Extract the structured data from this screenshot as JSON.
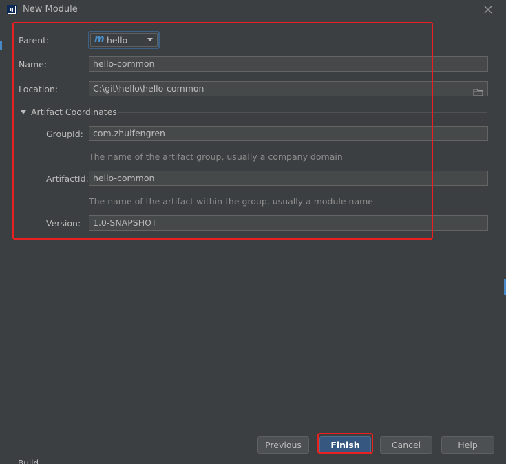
{
  "window": {
    "title": "New Module",
    "app_icon_text": "IJ"
  },
  "form": {
    "parent": {
      "label": "Parent:",
      "value": "hello",
      "icon": "maven-m-icon"
    },
    "name": {
      "label": "Name:",
      "value": "hello-common"
    },
    "location": {
      "label": "Location:",
      "value": "C:\\git\\hello\\hello-common",
      "browse_icon": "folder-icon"
    }
  },
  "artifact": {
    "section_label": "Artifact Coordinates",
    "expanded": true,
    "group_id": {
      "label": "GroupId:",
      "value": "com.zhuifengren",
      "hint": "The name of the artifact group, usually a company domain"
    },
    "artifact_id": {
      "label": "ArtifactId:",
      "value": "hello-common",
      "hint": "The name of the artifact within the group, usually a module name"
    },
    "version": {
      "label": "Version:",
      "value": "1.0-SNAPSHOT"
    }
  },
  "buttons": {
    "previous": "Previous",
    "finish": "Finish",
    "cancel": "Cancel",
    "help": "Help"
  },
  "background": {
    "partial_text": "Build"
  },
  "colors": {
    "background": "#3c3f41",
    "field": "#45494a",
    "accent": "#365880",
    "annotation_red": "#e8201f"
  }
}
